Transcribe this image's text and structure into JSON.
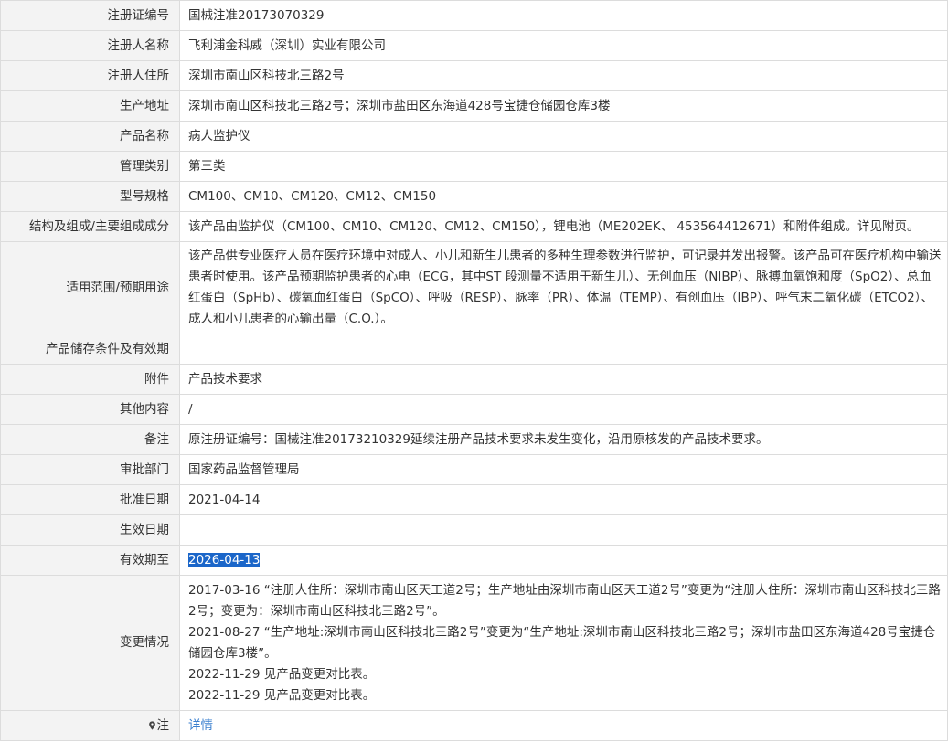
{
  "rows": [
    {
      "label": "注册证编号",
      "value": "国械注准20173070329"
    },
    {
      "label": "注册人名称",
      "value": "飞利浦金科威（深圳）实业有限公司"
    },
    {
      "label": "注册人住所",
      "value": "深圳市南山区科技北三路2号"
    },
    {
      "label": "生产地址",
      "value": "深圳市南山区科技北三路2号；深圳市盐田区东海道428号宝捷仓储园仓库3楼"
    },
    {
      "label": "产品名称",
      "value": "病人监护仪"
    },
    {
      "label": "管理类别",
      "value": "第三类"
    },
    {
      "label": "型号规格",
      "value": "CM100、CM10、CM120、CM12、CM150"
    },
    {
      "label": "结构及组成/主要组成成分",
      "value": "该产品由监护仪（CM100、CM10、CM120、CM12、CM150），锂电池（ME202EK、 453564412671）和附件组成。详见附页。"
    },
    {
      "label": "适用范围/预期用途",
      "value": "该产品供专业医疗人员在医疗环境中对成人、小儿和新生儿患者的多种生理参数进行监护，可记录并发出报警。该产品可在医疗机构中输送患者时使用。该产品预期监护患者的心电（ECG，其中ST 段测量不适用于新生儿）、无创血压（NIBP）、脉搏血氧饱和度（SpO2）、总血红蛋白（SpHb）、碳氧血红蛋白（SpCO）、呼吸（RESP）、脉率（PR）、体温（TEMP）、有创血压（IBP）、呼气末二氧化碳（ETCO2）、成人和小儿患者的心输出量（C.O.）。"
    },
    {
      "label": "产品储存条件及有效期",
      "value": ""
    },
    {
      "label": "附件",
      "value": "产品技术要求"
    },
    {
      "label": "其他内容",
      "value": "/"
    },
    {
      "label": "备注",
      "value": "原注册证编号：国械注准20173210329延续注册产品技术要求未发生变化，沿用原核发的产品技术要求。"
    },
    {
      "label": "审批部门",
      "value": "国家药品监督管理局"
    },
    {
      "label": "批准日期",
      "value": "2021-04-14"
    },
    {
      "label": "生效日期",
      "value": ""
    },
    {
      "label": "有效期至",
      "value": "2026-04-13"
    }
  ],
  "changes": {
    "label": "变更情况",
    "entries": [
      "2017-03-16 “注册人住所：深圳市南山区天工道2号；生产地址由深圳市南山区天工道2号”变更为“注册人住所：深圳市南山区科技北三路2号；变更为：深圳市南山区科技北三路2号”。",
      "2021-08-27 “生产地址:深圳市南山区科技北三路2号”变更为“生产地址:深圳市南山区科技北三路2号；深圳市盐田区东海道428号宝捷仓储园仓库3楼”。",
      "2022-11-29 见产品变更对比表。",
      "2022-11-29 见产品变更对比表。"
    ]
  },
  "note": {
    "label": "注",
    "icon": "location-pin-icon",
    "link_text": "详情"
  }
}
